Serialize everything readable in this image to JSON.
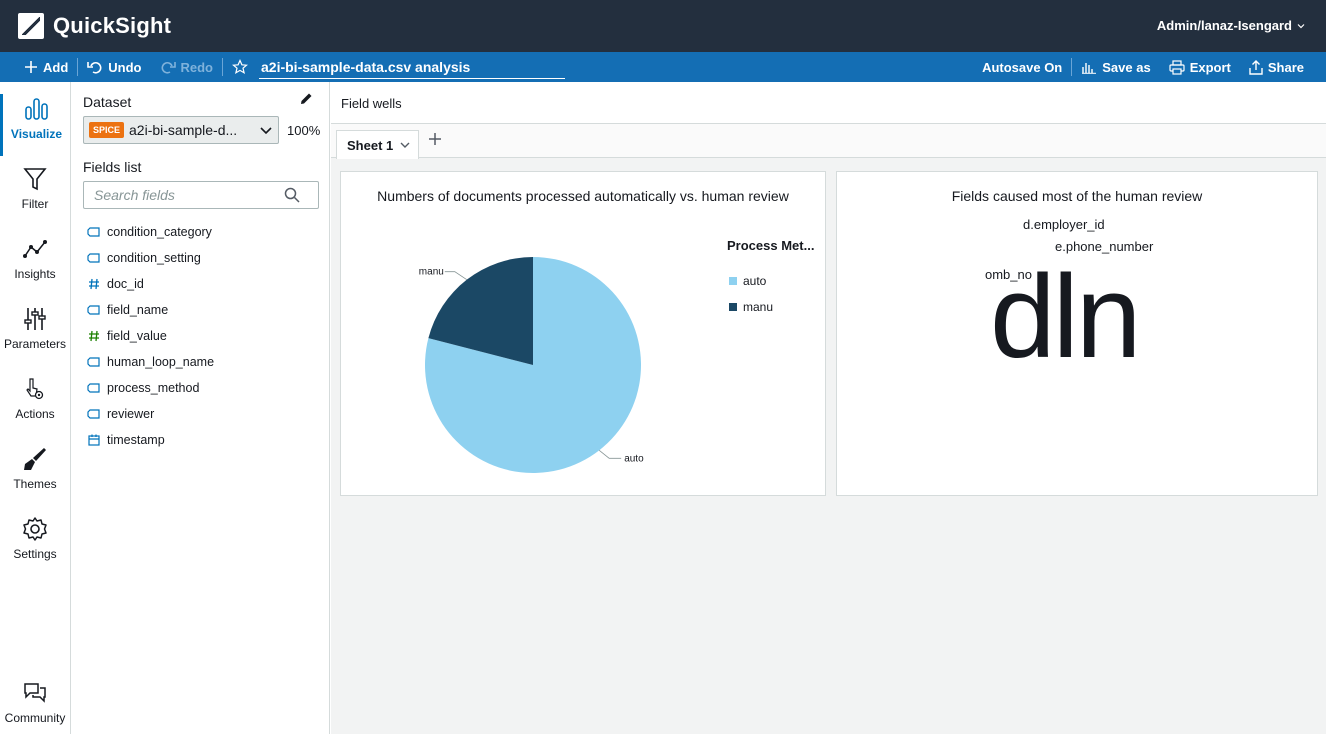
{
  "app": {
    "name": "QuickSight",
    "user": "Admin/lanaz-Isengard"
  },
  "toolbar": {
    "add": "Add",
    "undo": "Undo",
    "redo": "Redo",
    "analysis_title": "a2i-bi-sample-data.csv analysis",
    "autosave": "Autosave On",
    "save_as": "Save as",
    "export": "Export",
    "share": "Share"
  },
  "nav": {
    "items": [
      {
        "label": "Visualize",
        "icon": "bar-chart-icon",
        "active": true
      },
      {
        "label": "Filter",
        "icon": "filter-icon"
      },
      {
        "label": "Insights",
        "icon": "insights-icon"
      },
      {
        "label": "Parameters",
        "icon": "sliders-icon"
      },
      {
        "label": "Actions",
        "icon": "cursor-gear-icon"
      },
      {
        "label": "Themes",
        "icon": "brush-icon"
      },
      {
        "label": "Settings",
        "icon": "gear-icon"
      }
    ],
    "community": "Community"
  },
  "dataset": {
    "label": "Dataset",
    "badge": "SPICE",
    "name": "a2i-bi-sample-d...",
    "percent": "100%"
  },
  "fields": {
    "label": "Fields list",
    "search_placeholder": "Search fields",
    "items": [
      {
        "name": "condition_category",
        "type": "string"
      },
      {
        "name": "condition_setting",
        "type": "string"
      },
      {
        "name": "doc_id",
        "type": "number-dimension"
      },
      {
        "name": "field_name",
        "type": "string"
      },
      {
        "name": "field_value",
        "type": "number-measure"
      },
      {
        "name": "human_loop_name",
        "type": "string"
      },
      {
        "name": "process_method",
        "type": "string"
      },
      {
        "name": "reviewer",
        "type": "string"
      },
      {
        "name": "timestamp",
        "type": "date"
      }
    ]
  },
  "main": {
    "field_wells": "Field wells",
    "sheet_tab": "Sheet 1"
  },
  "visuals": {
    "pie": {
      "title": "Numbers of documents processed automatically vs. human review",
      "legend_title": "Process Met...",
      "label_auto": "auto",
      "label_manu": "manu"
    },
    "wordcloud": {
      "title": "Fields caused most of the human review",
      "words": [
        "d.employer_id",
        "e.phone_number",
        "omb_no",
        "dln"
      ]
    }
  },
  "chart_data": [
    {
      "type": "pie",
      "title": "Numbers of documents processed automatically vs. human review",
      "legend_title": "Process Met...",
      "categories": [
        "auto",
        "manu"
      ],
      "values": [
        79,
        21
      ],
      "colors": [
        "#8ed1f0",
        "#1b4865"
      ],
      "legend_position": "right"
    },
    {
      "type": "wordcloud",
      "title": "Fields caused most of the human review",
      "words": [
        "d.employer_id",
        "e.phone_number",
        "omb_no",
        "dln"
      ]
    }
  ]
}
